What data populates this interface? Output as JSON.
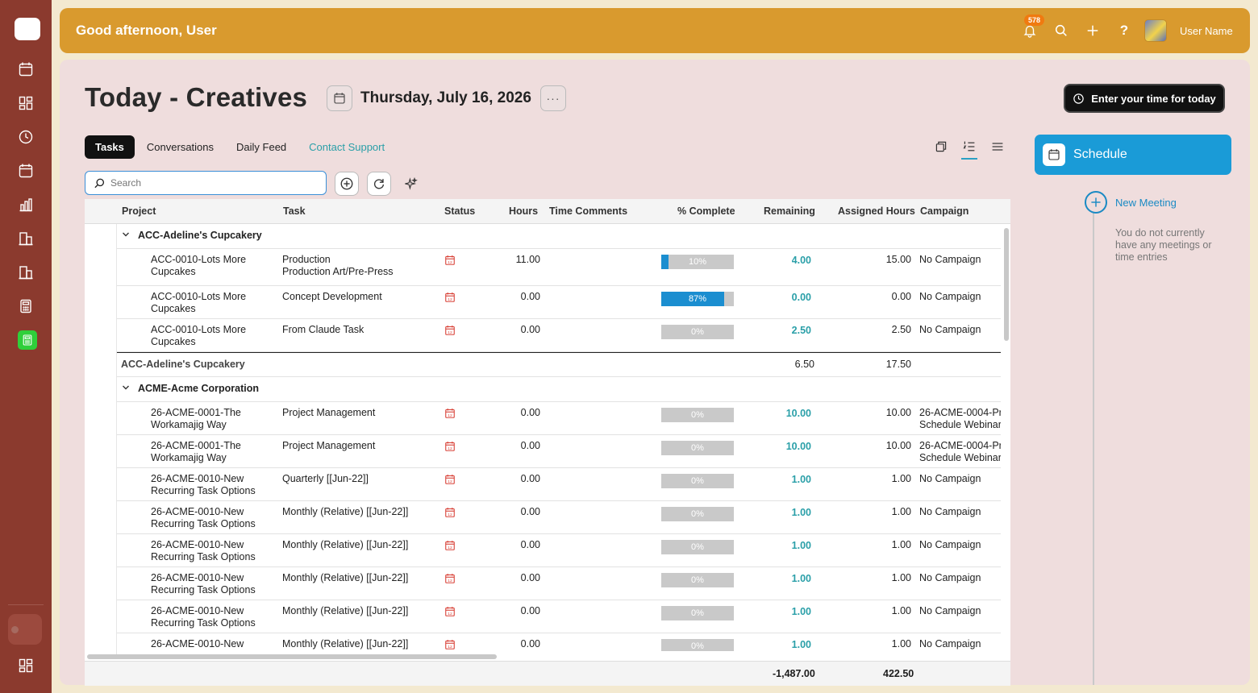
{
  "topbar": {
    "greeting": "Good afternoon, User",
    "notification_count": "578",
    "user_name": "User Name",
    "icons": [
      "bell-icon",
      "search-icon",
      "plus-icon",
      "help-icon"
    ]
  },
  "rail": {
    "icons": [
      "calendar-icon",
      "dashboard-icon",
      "clock-icon",
      "calendar-icon",
      "chart-icon",
      "building-icon",
      "building-icon",
      "calculator-icon",
      "calculator-icon-active",
      "dashboard-icon"
    ]
  },
  "page": {
    "title": "Today - Creatives",
    "date": "Thursday, July 16, 2026",
    "more_label": "···",
    "enter_time_label": "Enter your time for today"
  },
  "tabs": [
    {
      "label": "Tasks",
      "active": true
    },
    {
      "label": "Conversations"
    },
    {
      "label": "Daily Feed"
    },
    {
      "label": "Contact Support",
      "link": true
    }
  ],
  "search": {
    "placeholder": "Search",
    "value": ""
  },
  "grid": {
    "columns": [
      "Project",
      "Task",
      "Status",
      "Hours",
      "Time Comments",
      "% Complete",
      "Remaining",
      "Assigned Hours",
      "Campaign"
    ],
    "groups": [
      {
        "name": "ACC-Adeline's Cupcakery",
        "rows": [
          {
            "project1": "ACC-0010-Lots More",
            "project2": "Cupcakes",
            "task1": "Production",
            "task2": "Production Art/Pre-Press",
            "hours": "11.00",
            "pct": 10,
            "pct_label": "10%",
            "remaining": "4.00",
            "assigned": "15.00",
            "campaign1": "No Campaign",
            "campaign2": ""
          },
          {
            "project1": "ACC-0010-Lots More",
            "project2": "Cupcakes",
            "task1": "Concept Development",
            "task2": "",
            "hours": "0.00",
            "pct": 87,
            "pct_label": "87%",
            "remaining": "0.00",
            "assigned": "0.00",
            "campaign1": "No Campaign",
            "campaign2": ""
          },
          {
            "project1": "ACC-0010-Lots More",
            "project2": "Cupcakes",
            "task1": "From Claude Task",
            "task2": "",
            "hours": "0.00",
            "pct": 0,
            "pct_label": "0%",
            "remaining": "2.50",
            "assigned": "2.50",
            "campaign1": "No Campaign",
            "campaign2": ""
          }
        ],
        "total": {
          "label": "ACC-Adeline's Cupcakery",
          "remaining": "6.50",
          "assigned": "17.50"
        }
      },
      {
        "name": "ACME-Acme Corporation",
        "rows": [
          {
            "project1": "26-ACME-0001-The",
            "project2": "Workamajig Way",
            "task1": "Project Management",
            "task2": "",
            "hours": "0.00",
            "pct": 0,
            "pct_label": "0%",
            "remaining": "10.00",
            "assigned": "10.00",
            "campaign1": "26-ACME-0004-Pr",
            "campaign2": "Schedule Webinar"
          },
          {
            "project1": "26-ACME-0001-The",
            "project2": "Workamajig Way",
            "task1": "Project Management",
            "task2": "",
            "hours": "0.00",
            "pct": 0,
            "pct_label": "0%",
            "remaining": "10.00",
            "assigned": "10.00",
            "campaign1": "26-ACME-0004-Pr",
            "campaign2": "Schedule Webinar"
          },
          {
            "project1": "26-ACME-0010-New",
            "project2": "Recurring Task Options",
            "task1": "Quarterly [[Jun-22]]",
            "task2": "",
            "hours": "0.00",
            "pct": 0,
            "pct_label": "0%",
            "remaining": "1.00",
            "assigned": "1.00",
            "campaign1": "No Campaign",
            "campaign2": ""
          },
          {
            "project1": "26-ACME-0010-New",
            "project2": "Recurring Task Options",
            "task1": "Monthly (Relative) [[Jun-22]]",
            "task2": "",
            "hours": "0.00",
            "pct": 0,
            "pct_label": "0%",
            "remaining": "1.00",
            "assigned": "1.00",
            "campaign1": "No Campaign",
            "campaign2": ""
          },
          {
            "project1": "26-ACME-0010-New",
            "project2": "Recurring Task Options",
            "task1": "Monthly (Relative) [[Jun-22]]",
            "task2": "",
            "hours": "0.00",
            "pct": 0,
            "pct_label": "0%",
            "remaining": "1.00",
            "assigned": "1.00",
            "campaign1": "No Campaign",
            "campaign2": ""
          },
          {
            "project1": "26-ACME-0010-New",
            "project2": "Recurring Task Options",
            "task1": "Monthly (Relative) [[Jun-22]]",
            "task2": "",
            "hours": "0.00",
            "pct": 0,
            "pct_label": "0%",
            "remaining": "1.00",
            "assigned": "1.00",
            "campaign1": "No Campaign",
            "campaign2": ""
          },
          {
            "project1": "26-ACME-0010-New",
            "project2": "Recurring Task Options",
            "task1": "Monthly (Relative) [[Jun-22]]",
            "task2": "",
            "hours": "0.00",
            "pct": 0,
            "pct_label": "0%",
            "remaining": "1.00",
            "assigned": "1.00",
            "campaign1": "No Campaign",
            "campaign2": ""
          },
          {
            "project1": "26-ACME-0010-New",
            "project2": "",
            "task1": "Monthly (Relative) [[Jun-22]]",
            "task2": "",
            "hours": "0.00",
            "pct": 0,
            "pct_label": "0%",
            "remaining": "1.00",
            "assigned": "1.00",
            "campaign1": "No Campaign",
            "campaign2": ""
          }
        ]
      }
    ],
    "footer": {
      "remaining": "-1,487.00",
      "assigned": "422.50"
    }
  },
  "schedule": {
    "title": "Schedule",
    "new_meeting": "New Meeting",
    "empty_message": "You do not currently have any meetings or time entries"
  },
  "colors": {
    "accent": "#1a9bd7",
    "topbar": "#d99a2e",
    "rail": "#8b3a2e",
    "remaining_text": "#2a9fa8",
    "status_icon": "#d9443a"
  }
}
